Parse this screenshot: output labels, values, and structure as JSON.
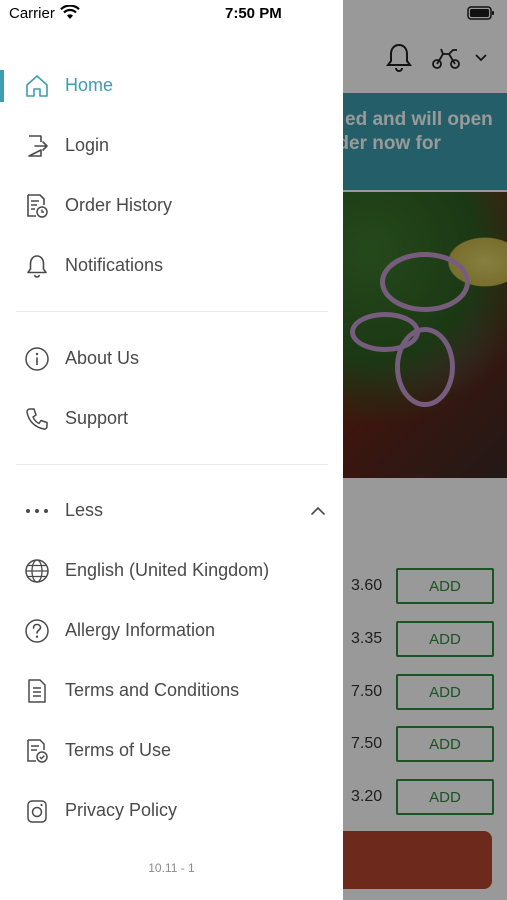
{
  "status_bar": {
    "carrier": "Carrier",
    "time": "7:50 PM"
  },
  "background": {
    "banner_line_1": "ed and will open",
    "banner_line_2": "rder now for",
    "items": [
      {
        "price": "3.60",
        "add_label": "ADD"
      },
      {
        "price": "3.35",
        "add_label": "ADD"
      },
      {
        "price": "7.50",
        "add_label": "ADD"
      },
      {
        "price": "7.50",
        "add_label": "ADD"
      },
      {
        "price": "3.20",
        "add_label": "ADD"
      }
    ]
  },
  "drawer": {
    "primary": [
      {
        "label": "Home",
        "icon": "home-icon",
        "active": true
      },
      {
        "label": "Login",
        "icon": "login-icon"
      },
      {
        "label": "Order History",
        "icon": "order-history-icon"
      },
      {
        "label": "Notifications",
        "icon": "bell-icon"
      }
    ],
    "secondary": [
      {
        "label": "About Us",
        "icon": "info-icon"
      },
      {
        "label": "Support",
        "icon": "phone-icon"
      }
    ],
    "more_toggle": {
      "label": "Less",
      "icon": "more-dots-icon"
    },
    "extra": [
      {
        "label": "English (United Kingdom)",
        "icon": "globe-icon"
      },
      {
        "label": "Allergy Information",
        "icon": "question-circle-icon"
      },
      {
        "label": "Terms and Conditions",
        "icon": "document-icon"
      },
      {
        "label": "Terms of Use",
        "icon": "document-check-icon"
      },
      {
        "label": "Privacy Policy",
        "icon": "privacy-icon"
      }
    ],
    "version": "10.11 - 1"
  },
  "colors": {
    "accent": "#3c9eb0",
    "add_button": "#2e8b3c",
    "cta": "#b4452f"
  }
}
